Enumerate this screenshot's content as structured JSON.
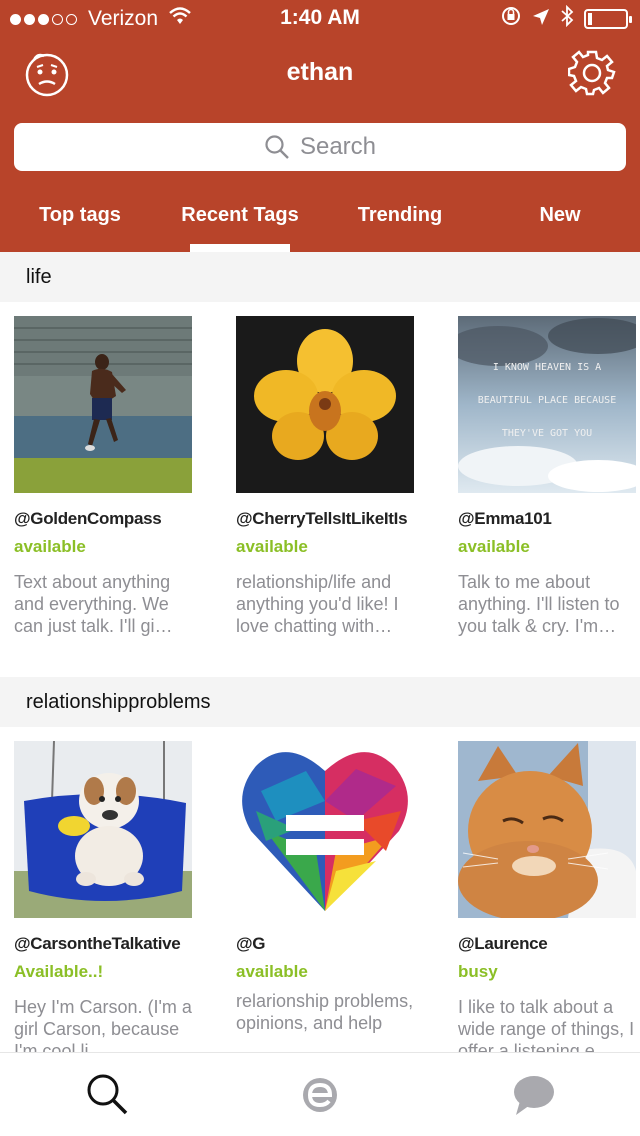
{
  "status_bar": {
    "carrier": "Verizon",
    "time": "1:40 AM"
  },
  "header": {
    "title": "ethan",
    "search_placeholder": "Search"
  },
  "tabs": [
    {
      "label": "Top tags"
    },
    {
      "label": "Recent Tags"
    },
    {
      "label": "Trending"
    },
    {
      "label": "New"
    }
  ],
  "active_tab": "Recent Tags",
  "sections": [
    {
      "title": "life",
      "cards": [
        {
          "username": "@GoldenCompass",
          "status": "available",
          "description": "Text about anything and everything. We can just talk. I'll gi…"
        },
        {
          "username": "@CherryTellsItLikeItIs",
          "status": "available",
          "description": "relationship/life and anything you'd like! I love chatting with…"
        },
        {
          "username": "@Emma101",
          "status": "available",
          "description": "Talk to me about anything. I'll listen to you talk & cry. I'm…",
          "image_text": [
            "I KNOW HEAVEN IS A",
            "BEAUTIFUL PLACE BECAUSE",
            "THEY'VE GOT YOU"
          ]
        }
      ]
    },
    {
      "title": "relationshipproblems",
      "cards": [
        {
          "username": "@CarsontheTalkative",
          "status": "Available..!",
          "description": "Hey I'm Carson. (I'm a girl Carson, because I'm cool li…"
        },
        {
          "username": "@G",
          "status": "available",
          "description": "relarionship problems, opinions, and help"
        },
        {
          "username": "@Laurence",
          "status": "busy",
          "description": "I like to talk about a wide range of things, I offer a listening e…"
        }
      ]
    }
  ],
  "icons": {
    "profile": "face-icon",
    "settings": "gear-icon",
    "search": "search-icon",
    "tabbar": [
      "search-icon",
      "e-logo-icon",
      "chat-bubble-icon"
    ]
  },
  "colors": {
    "header_bg": "#b8442a",
    "status_available": "#8bbf26",
    "text_secondary": "#8e8e93"
  }
}
